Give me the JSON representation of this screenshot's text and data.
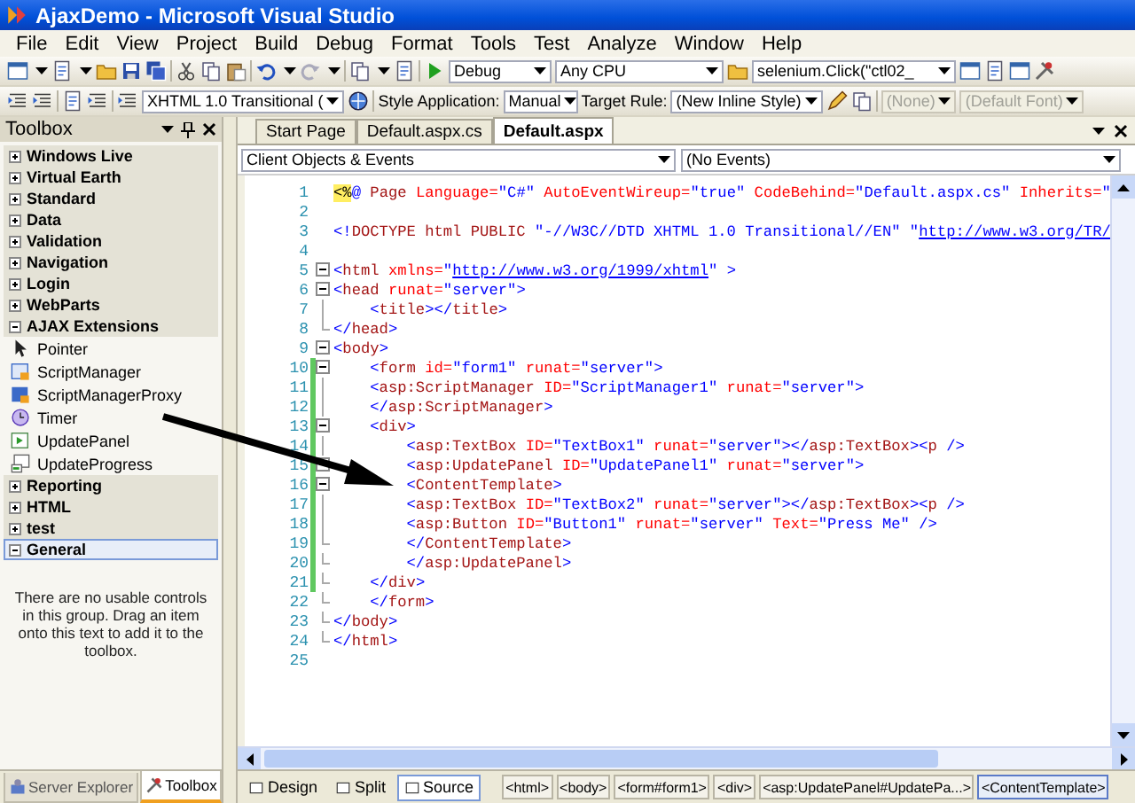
{
  "window": {
    "title": "AjaxDemo - Microsoft Visual Studio"
  },
  "menu": [
    "File",
    "Edit",
    "View",
    "Project",
    "Build",
    "Debug",
    "Format",
    "Tools",
    "Test",
    "Analyze",
    "Window",
    "Help"
  ],
  "toolbar_1": {
    "configuration": "Debug",
    "platform": "Any CPU",
    "find": "selenium.Click(\"ctl02_"
  },
  "toolbar_2": {
    "doctype": "XHTML 1.0 Transitional (",
    "style_application_label": "Style Application:",
    "style_application": "Manual",
    "target_rule_label": "Target Rule:",
    "target_rule": "(New Inline Style)",
    "combos": [
      {
        "value": "(None)",
        "disabled": true
      },
      {
        "value": "(Default Font)",
        "disabled": true
      }
    ]
  },
  "toolbox": {
    "title": "Toolbox",
    "groups": [
      {
        "label": "Windows Live",
        "expanded": false,
        "selected": false
      },
      {
        "label": "Virtual Earth",
        "expanded": false,
        "selected": false
      },
      {
        "label": "Standard",
        "expanded": false,
        "selected": false
      },
      {
        "label": "Data",
        "expanded": false,
        "selected": false
      },
      {
        "label": "Validation",
        "expanded": false,
        "selected": false
      },
      {
        "label": "Navigation",
        "expanded": false,
        "selected": false
      },
      {
        "label": "Login",
        "expanded": false,
        "selected": false
      },
      {
        "label": "WebParts",
        "expanded": false,
        "selected": false
      },
      {
        "label": "AJAX Extensions",
        "expanded": true,
        "selected": false,
        "items": [
          "Pointer",
          "ScriptManager",
          "ScriptManagerProxy",
          "Timer",
          "UpdatePanel",
          "UpdateProgress"
        ]
      },
      {
        "label": "Reporting",
        "expanded": false,
        "selected": false
      },
      {
        "label": "HTML",
        "expanded": false,
        "selected": false
      },
      {
        "label": "test",
        "expanded": false,
        "selected": false
      },
      {
        "label": "General",
        "expanded": true,
        "selected": true,
        "empty_message": "There are no usable controls in this group. Drag an item onto this text to add it to the toolbox."
      }
    ]
  },
  "editor": {
    "tabs": [
      {
        "label": "Start Page",
        "selected": false
      },
      {
        "label": "Default.aspx.cs",
        "selected": false
      },
      {
        "label": "Default.aspx",
        "selected": true
      }
    ],
    "object_combo": "Client Objects & Events",
    "event_combo": "(No Events)",
    "lines": [
      {
        "number": "1",
        "changed": false,
        "tokens": [
          {
            "kind": "server",
            "text": "<%"
          },
          {
            "kind": "delim",
            "text": "@ "
          },
          {
            "kind": "tag",
            "text": "Page "
          },
          {
            "kind": "attr",
            "text": "Language="
          },
          {
            "kind": "value",
            "text": "\"C#\" "
          },
          {
            "kind": "attr",
            "text": "AutoEventWireup="
          },
          {
            "kind": "value",
            "text": "\"true\" "
          },
          {
            "kind": "attr",
            "text": "CodeBehind="
          },
          {
            "kind": "value",
            "text": "\"Default.aspx.cs\" "
          },
          {
            "kind": "attr",
            "text": "Inherits="
          },
          {
            "kind": "value",
            "text": "\""
          }
        ]
      },
      {
        "number": "2",
        "changed": false
      },
      {
        "number": "3",
        "changed": false,
        "tokens": [
          {
            "kind": "delim",
            "text": "<!"
          },
          {
            "kind": "tag",
            "text": "DOCTYPE html PUBLIC "
          },
          {
            "kind": "value",
            "text": "\"-//W3C//DTD XHTML 1.0 Transitional//EN\" \""
          },
          {
            "kind": "link",
            "text": "http://www.w3.org/TR/"
          }
        ]
      },
      {
        "number": "4",
        "changed": false
      },
      {
        "number": "5",
        "changed": false,
        "fold_toggle": true,
        "tokens": [
          {
            "kind": "delim",
            "text": "<"
          },
          {
            "kind": "tag",
            "text": "html "
          },
          {
            "kind": "attr",
            "text": "xmlns="
          },
          {
            "kind": "value",
            "text": "\""
          },
          {
            "kind": "link",
            "text": "http://www.w3.org/1999/xhtml"
          },
          {
            "kind": "value",
            "text": "\" "
          },
          {
            "kind": "delim",
            "text": ">"
          }
        ]
      },
      {
        "number": "6",
        "changed": false,
        "fold_toggle": true,
        "tokens": [
          {
            "kind": "delim",
            "text": "<"
          },
          {
            "kind": "tag",
            "text": "head "
          },
          {
            "kind": "attr",
            "text": "runat="
          },
          {
            "kind": "value",
            "text": "\"server\""
          },
          {
            "kind": "delim",
            "text": ">"
          }
        ]
      },
      {
        "number": "7",
        "changed": false,
        "fold_guide": true,
        "tokens": [
          {
            "kind": "delim",
            "text": "    <"
          },
          {
            "kind": "tag",
            "text": "title"
          },
          {
            "kind": "delim",
            "text": "></"
          },
          {
            "kind": "tag",
            "text": "title"
          },
          {
            "kind": "delim",
            "text": ">"
          }
        ]
      },
      {
        "number": "8",
        "changed": false,
        "fold_end": true,
        "tokens": [
          {
            "kind": "delim",
            "text": "</"
          },
          {
            "kind": "tag",
            "text": "head"
          },
          {
            "kind": "delim",
            "text": ">"
          }
        ]
      },
      {
        "number": "9",
        "changed": false,
        "fold_toggle": true,
        "tokens": [
          {
            "kind": "delim",
            "text": "<"
          },
          {
            "kind": "tag",
            "text": "body"
          },
          {
            "kind": "delim",
            "text": ">"
          }
        ]
      },
      {
        "number": "10",
        "changed": true,
        "fold_toggle": true,
        "tokens": [
          {
            "kind": "delim",
            "text": "    <"
          },
          {
            "kind": "tag",
            "text": "form "
          },
          {
            "kind": "attr",
            "text": "id="
          },
          {
            "kind": "value",
            "text": "\"form1\" "
          },
          {
            "kind": "attr",
            "text": "runat="
          },
          {
            "kind": "value",
            "text": "\"server\""
          },
          {
            "kind": "delim",
            "text": ">"
          }
        ]
      },
      {
        "number": "11",
        "changed": true,
        "fold_guide": true,
        "tokens": [
          {
            "kind": "delim",
            "text": "    <"
          },
          {
            "kind": "tag",
            "text": "asp:ScriptManager "
          },
          {
            "kind": "attr",
            "text": "ID="
          },
          {
            "kind": "value",
            "text": "\"ScriptManager1\" "
          },
          {
            "kind": "attr",
            "text": "runat="
          },
          {
            "kind": "value",
            "text": "\"server\""
          },
          {
            "kind": "delim",
            "text": ">"
          }
        ]
      },
      {
        "number": "12",
        "changed": true,
        "fold_guide": true,
        "tokens": [
          {
            "kind": "delim",
            "text": "    </"
          },
          {
            "kind": "tag",
            "text": "asp:ScriptManager"
          },
          {
            "kind": "delim",
            "text": ">"
          }
        ]
      },
      {
        "number": "13",
        "changed": true,
        "fold_toggle": true,
        "tokens": [
          {
            "kind": "delim",
            "text": "    <"
          },
          {
            "kind": "tag",
            "text": "div"
          },
          {
            "kind": "delim",
            "text": ">"
          }
        ]
      },
      {
        "number": "14",
        "changed": true,
        "fold_guide": true,
        "tokens": [
          {
            "kind": "delim",
            "text": "        <"
          },
          {
            "kind": "tag",
            "text": "asp:TextBox "
          },
          {
            "kind": "attr",
            "text": "ID="
          },
          {
            "kind": "value",
            "text": "\"TextBox1\" "
          },
          {
            "kind": "attr",
            "text": "runat="
          },
          {
            "kind": "value",
            "text": "\"server\""
          },
          {
            "kind": "delim",
            "text": "></"
          },
          {
            "kind": "tag",
            "text": "asp:TextBox"
          },
          {
            "kind": "delim",
            "text": "><"
          },
          {
            "kind": "tag",
            "text": "p "
          },
          {
            "kind": "delim",
            "text": "/>"
          }
        ]
      },
      {
        "number": "15",
        "changed": true,
        "fold_toggle": true,
        "tokens": [
          {
            "kind": "delim",
            "text": "        <"
          },
          {
            "kind": "tag",
            "text": "asp:UpdatePanel "
          },
          {
            "kind": "attr",
            "text": "ID="
          },
          {
            "kind": "value",
            "text": "\"UpdatePanel1\" "
          },
          {
            "kind": "attr",
            "text": "runat="
          },
          {
            "kind": "value",
            "text": "\"server\""
          },
          {
            "kind": "delim",
            "text": ">"
          }
        ]
      },
      {
        "number": "16",
        "changed": true,
        "fold_toggle": true,
        "tokens": [
          {
            "kind": "delim",
            "text": "        <"
          },
          {
            "kind": "tag",
            "text": "ContentTemplate"
          },
          {
            "kind": "delim",
            "text": ">"
          }
        ]
      },
      {
        "number": "17",
        "changed": true,
        "fold_guide": true,
        "tokens": [
          {
            "kind": "delim",
            "text": "        <"
          },
          {
            "kind": "tag",
            "text": "asp:TextBox "
          },
          {
            "kind": "attr",
            "text": "ID="
          },
          {
            "kind": "value",
            "text": "\"TextBox2\" "
          },
          {
            "kind": "attr",
            "text": "runat="
          },
          {
            "kind": "value",
            "text": "\"server\""
          },
          {
            "kind": "delim",
            "text": "></"
          },
          {
            "kind": "tag",
            "text": "asp:TextBox"
          },
          {
            "kind": "delim",
            "text": "><"
          },
          {
            "kind": "tag",
            "text": "p "
          },
          {
            "kind": "delim",
            "text": "/>"
          }
        ]
      },
      {
        "number": "18",
        "changed": true,
        "fold_guide": true,
        "tokens": [
          {
            "kind": "delim",
            "text": "        <"
          },
          {
            "kind": "tag",
            "text": "asp:Button "
          },
          {
            "kind": "attr",
            "text": "ID="
          },
          {
            "kind": "value",
            "text": "\"Button1\" "
          },
          {
            "kind": "attr",
            "text": "runat="
          },
          {
            "kind": "value",
            "text": "\"server\" "
          },
          {
            "kind": "attr",
            "text": "Text="
          },
          {
            "kind": "value",
            "text": "\"Press Me\" "
          },
          {
            "kind": "delim",
            "text": "/>"
          }
        ]
      },
      {
        "number": "19",
        "changed": true,
        "fold_end": true,
        "tokens": [
          {
            "kind": "delim",
            "text": "        </"
          },
          {
            "kind": "tag",
            "text": "ContentTemplate"
          },
          {
            "kind": "delim",
            "text": ">"
          }
        ]
      },
      {
        "number": "20",
        "changed": true,
        "fold_end": true,
        "tokens": [
          {
            "kind": "delim",
            "text": "        </"
          },
          {
            "kind": "tag",
            "text": "asp:UpdatePanel"
          },
          {
            "kind": "delim",
            "text": ">"
          }
        ]
      },
      {
        "number": "21",
        "changed": true,
        "fold_end": true,
        "tokens": [
          {
            "kind": "delim",
            "text": "    </"
          },
          {
            "kind": "tag",
            "text": "div"
          },
          {
            "kind": "delim",
            "text": ">"
          }
        ]
      },
      {
        "number": "22",
        "changed": false,
        "fold_end": true,
        "tokens": [
          {
            "kind": "delim",
            "text": "    </"
          },
          {
            "kind": "tag",
            "text": "form"
          },
          {
            "kind": "delim",
            "text": ">"
          }
        ]
      },
      {
        "number": "23",
        "changed": false,
        "fold_end": true,
        "tokens": [
          {
            "kind": "delim",
            "text": "</"
          },
          {
            "kind": "tag",
            "text": "body"
          },
          {
            "kind": "delim",
            "text": ">"
          }
        ]
      },
      {
        "number": "24",
        "changed": false,
        "fold_end": true,
        "tokens": [
          {
            "kind": "delim",
            "text": "</"
          },
          {
            "kind": "tag",
            "text": "html"
          },
          {
            "kind": "delim",
            "text": ">"
          }
        ]
      },
      {
        "number": "25",
        "changed": false
      }
    ],
    "views": [
      {
        "label": "Design",
        "selected": false
      },
      {
        "label": "Split",
        "selected": false
      },
      {
        "label": "Source",
        "selected": true
      }
    ],
    "breadcrumbs": [
      {
        "label": "<html>",
        "selected": false
      },
      {
        "label": "<body>",
        "selected": false
      },
      {
        "label": "<form#form1>",
        "selected": false
      },
      {
        "label": "<div>",
        "selected": false
      },
      {
        "label": "<asp:UpdatePanel#UpdatePa...>",
        "selected": false
      },
      {
        "label": "<ContentTemplate>",
        "selected": true
      }
    ]
  },
  "bottom_tabs": [
    {
      "label": "Server Explorer",
      "selected": false
    },
    {
      "label": "Toolbox",
      "selected": true
    }
  ]
}
